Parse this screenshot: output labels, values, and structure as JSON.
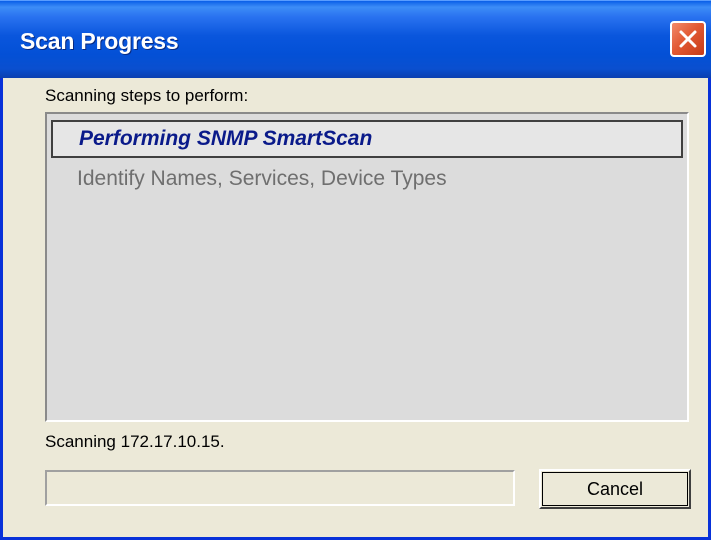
{
  "window": {
    "title": "Scan Progress",
    "close_icon": "close-x-icon"
  },
  "steps": {
    "label": "Scanning steps to perform:",
    "items": [
      {
        "label": "Performing SNMP SmartScan",
        "state": "active"
      },
      {
        "label": "Identify Names, Services, Device Types",
        "state": "pending"
      }
    ]
  },
  "status": {
    "text": "Scanning 172.17.10.15."
  },
  "progress": {
    "value_fraction": 0
  },
  "buttons": {
    "cancel_label": "Cancel"
  },
  "colors": {
    "titlebar": "#0a56dd",
    "close_button": "#e25a34",
    "active_step_text": "#0a1a8a",
    "pending_step_text": "#6f6f6f"
  }
}
